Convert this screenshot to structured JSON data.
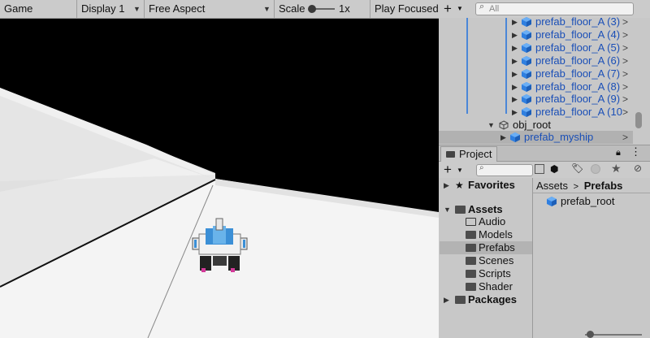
{
  "game_toolbar": {
    "tab_label": "Game",
    "display": "Display 1",
    "aspect": "Free Aspect",
    "scale_label": "Scale",
    "scale_value": "1x",
    "play_mode": "Play Focused"
  },
  "hierarchy": {
    "add_label": "+",
    "search_placeholder": "All",
    "items": [
      {
        "label": "prefab_floor_A (3)"
      },
      {
        "label": "prefab_floor_A (4)"
      },
      {
        "label": "prefab_floor_A (5)"
      },
      {
        "label": "prefab_floor_A (6)"
      },
      {
        "label": "prefab_floor_A (7)"
      },
      {
        "label": "prefab_floor_A (8)"
      },
      {
        "label": "prefab_floor_A (9)"
      },
      {
        "label": "prefab_floor_A (10"
      }
    ],
    "obj_root": "obj_root",
    "myship": "prefab_myship"
  },
  "project": {
    "tab_label": "Project",
    "add_label": "+",
    "favorites": "Favorites",
    "assets": "Assets",
    "folders": [
      "Audio",
      "Models",
      "Prefabs",
      "Scenes",
      "Scripts",
      "Shader"
    ],
    "packages": "Packages",
    "breadcrumb_root": "Assets",
    "breadcrumb_current": "Prefabs",
    "files": [
      {
        "label": "prefab_root"
      }
    ]
  },
  "colors": {
    "prefab_blue": "#1a4fb7",
    "cube_blue": "#2f7fe0",
    "ship_blue": "#3b8fd6"
  }
}
